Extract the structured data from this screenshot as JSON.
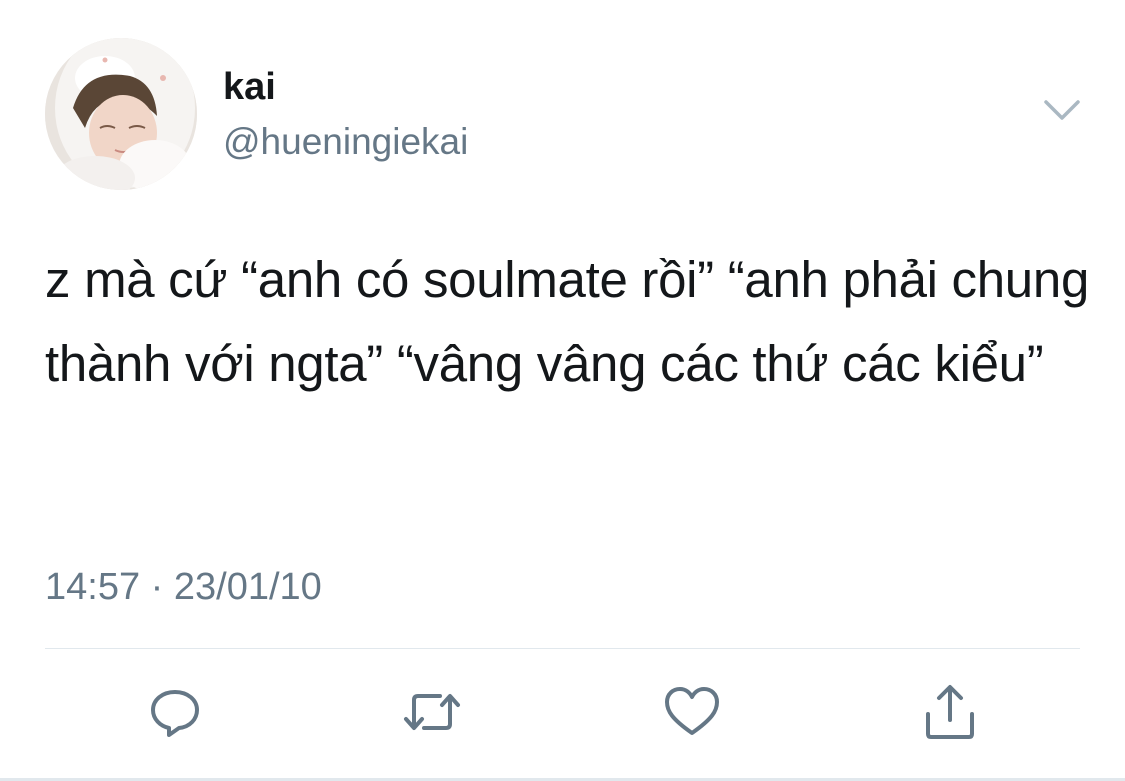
{
  "user": {
    "display_name": "kai",
    "handle": "@hueningiekai",
    "avatar_icon": "profile-photo"
  },
  "tweet": {
    "text": "z mà cứ “anh có soulmate rồi” “anh phải chung thành với ngta” “vâng vâng các thứ các kiểu”",
    "timestamp": "14:57 · 23/01/10"
  },
  "actions": {
    "reply_icon": "comment-icon",
    "retweet_icon": "retweet-icon",
    "like_icon": "heart-icon",
    "share_icon": "share-icon"
  },
  "colors": {
    "primary_text": "#14171a",
    "secondary_text": "#657786",
    "divider": "#e1e8ed",
    "icon": "#657786"
  }
}
